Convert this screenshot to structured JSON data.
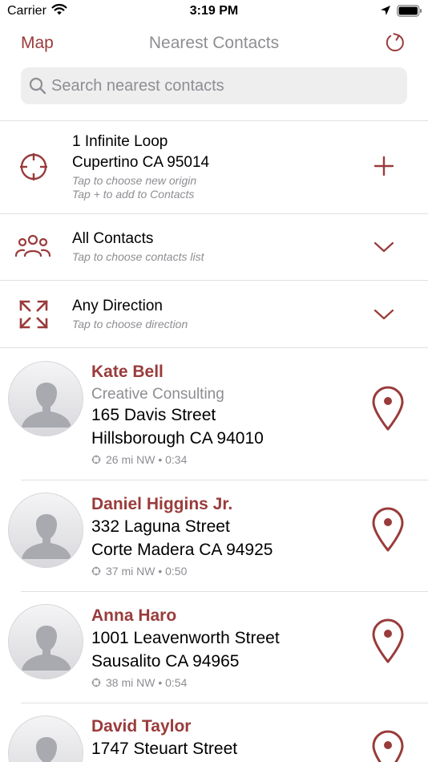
{
  "status_bar": {
    "carrier": "Carrier",
    "time": "3:19 PM"
  },
  "nav": {
    "left_label": "Map",
    "title": "Nearest Contacts",
    "right_icon": "refresh-icon"
  },
  "search": {
    "placeholder": "Search nearest contacts",
    "value": ""
  },
  "origin": {
    "line1": "1 Infinite Loop",
    "line2": "Cupertino CA 95014",
    "hint1": "Tap to choose new origin",
    "hint2": "Tap + to add to Contacts",
    "icon": "crosshair-icon",
    "action_icon": "plus-icon"
  },
  "contacts_list": {
    "title": "All Contacts",
    "hint": "Tap to choose contacts list",
    "icon": "people-icon",
    "action_icon": "chevron-down-icon"
  },
  "direction": {
    "title": "Any Direction",
    "hint": "Tap to choose direction",
    "icon": "expand-arrows-icon",
    "action_icon": "chevron-down-icon"
  },
  "contacts": [
    {
      "name": "Kate Bell",
      "company": "Creative Consulting",
      "street": "165 Davis Street",
      "city": "Hillsborough CA 94010",
      "meta": "26 mi NW • 0:34"
    },
    {
      "name": "Daniel Higgins Jr.",
      "street": "332 Laguna Street",
      "city": "Corte Madera CA 94925",
      "meta": "37 mi NW • 0:50"
    },
    {
      "name": "Anna Haro",
      "street": "1001  Leavenworth Street",
      "city": "Sausalito CA 94965",
      "meta": "38 mi NW • 0:54"
    },
    {
      "name": "David Taylor",
      "street": "1747 Steuart Street"
    }
  ],
  "colors": {
    "accent": "#9a3b3b",
    "secondary_text": "#8e8e93",
    "search_bg": "#eeeeef",
    "divider": "#e0e0e3"
  }
}
